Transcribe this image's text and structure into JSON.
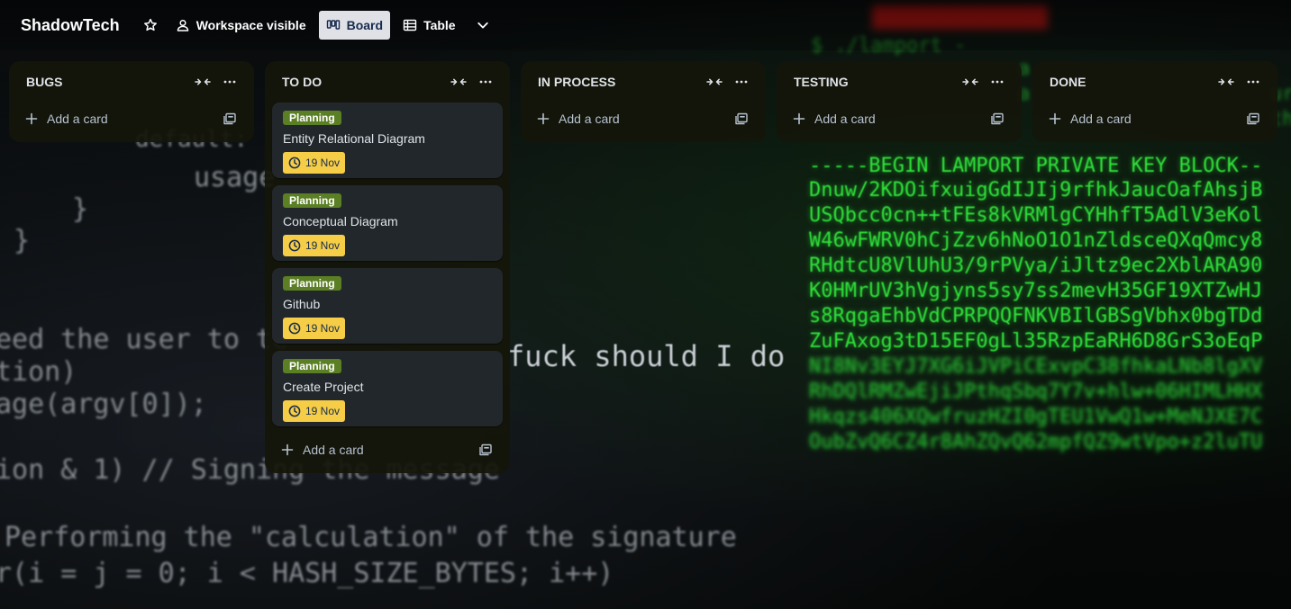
{
  "board": {
    "title": "ShadowTech",
    "visibility_label": "Workspace visible",
    "views": [
      {
        "label": "Board",
        "icon": "board-icon",
        "active": true
      },
      {
        "label": "Table",
        "icon": "table-icon",
        "active": false
      }
    ]
  },
  "colors": {
    "label_green": "#5b7f24",
    "due_yellow": "#f5cd47",
    "card_bg": "#22272b",
    "active_view_bg": "#dfe1e6"
  },
  "add_card_label": "Add a card",
  "lists": [
    {
      "title": "BUGS",
      "cards": []
    },
    {
      "title": "TO DO",
      "cards": [
        {
          "label": "Planning",
          "title": "Entity Relational Diagram",
          "due": "19 Nov"
        },
        {
          "label": "Planning",
          "title": "Conceptual Diagram",
          "due": "19 Nov"
        },
        {
          "label": "Planning",
          "title": "Github",
          "due": "19 Nov"
        },
        {
          "label": "Planning",
          "title": "Create Project",
          "due": "19 Nov"
        }
      ]
    },
    {
      "title": "IN PROCESS",
      "cards": []
    },
    {
      "title": "TESTING",
      "cards": []
    },
    {
      "title": "DONE",
      "cards": []
    }
  ],
  "background": {
    "left_code": [
      "default:",
      "usage",
      "}",
      "}",
      "eed the user to te",
      "tion)",
      "age(argv[0]);",
      "ion & 1) // Signing the message",
      "Performing the \"calculation\" of the signature",
      "r(i = j = 0; i < HASH_SIZE_BYTES; i++)"
    ],
    "middle_text": "fuck should I do",
    "top_code": [
      "$ ./lamport -",
      "a",
      "a",
      "ur",
      "th"
    ],
    "key_block": [
      "-----BEGIN LAMPORT PRIVATE KEY BLOCK--",
      "Dnuw/2KDOifxuigGdIJIj9rfhkJaucOafAhsjB",
      "USQbcc0cn++tFEs8kVRMlgCYHhfT5AdlV3eKol",
      "W46wFWRV0hCjZzv6hNoO1O1nZldsceQXqQmcy8",
      "RHdtcU8VlUhU3/9rPVya/iJltz9ec2XblARA90",
      "K0HMrUV3hVgjyns5sy7ss2mevH35GF19XTZwHJ",
      "s8RqgaEhbVdCPRPQQFNKVBIlGBSgVbhx0bgTDd",
      "ZuFAxog3tD15EF0gLl35RzpEaRH6D8GrS3oEqP",
      "NI8Nv3EYJ7XG6iJVPiCExvpC38fhkaLNb8lgXV",
      "RhDQlRMZwEjiJPthqSbq7Y7v+hlw+06HIMLHHX",
      "Hkqzs406XQwfruzHZI0gTEU1VwQ1w+MeNJXE7C",
      "OubZvQ6CZ4r8AhZQvQ62mpfQZ9wtVpo+z2luTU"
    ]
  }
}
